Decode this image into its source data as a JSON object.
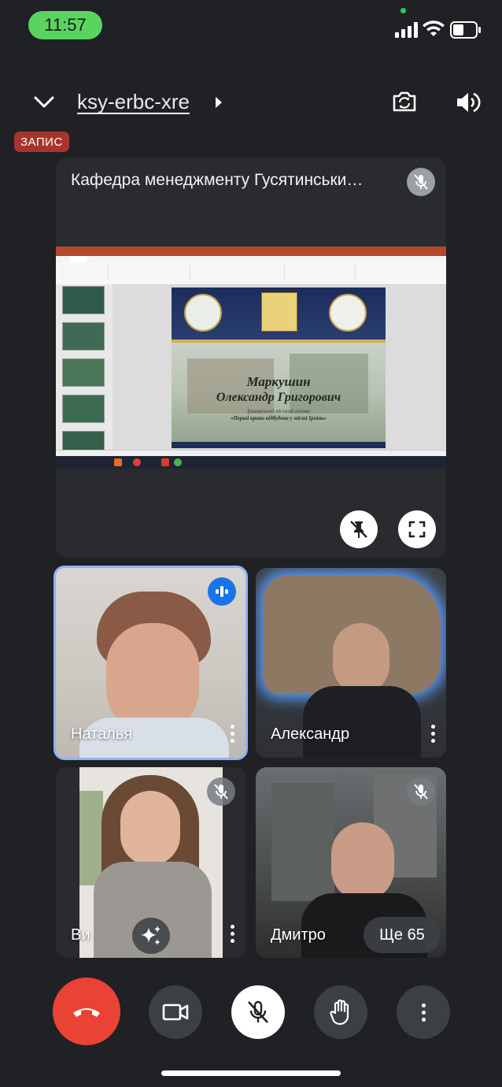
{
  "status_bar": {
    "time": "11:57"
  },
  "top_bar": {
    "meeting_code": "ksy-erbc-xre",
    "recording_label": "ЗАПИС"
  },
  "presentation": {
    "title": "Кафедра менеджменту Гусятинськи…",
    "slide": {
      "speaker_name": "Маркушин",
      "speaker_full": "Олександр Григорович",
      "role": "Іршавський міський голова",
      "topic": "«Перші кроки відбудови у місті Ірпінь»"
    }
  },
  "participants": [
    {
      "name": "Наталья",
      "speaking": true,
      "muted": false
    },
    {
      "name": "Александр",
      "speaking": false,
      "muted": false
    },
    {
      "name": "Ви",
      "speaking": false,
      "muted": true
    },
    {
      "name": "Дмитро",
      "speaking": false,
      "muted": true
    }
  ],
  "more_participants_label": "Ще 65",
  "colors": {
    "background": "#202124",
    "end_call": "#ea4335",
    "active_speaker": "#8ab4f8",
    "recording": "#a8342f"
  }
}
